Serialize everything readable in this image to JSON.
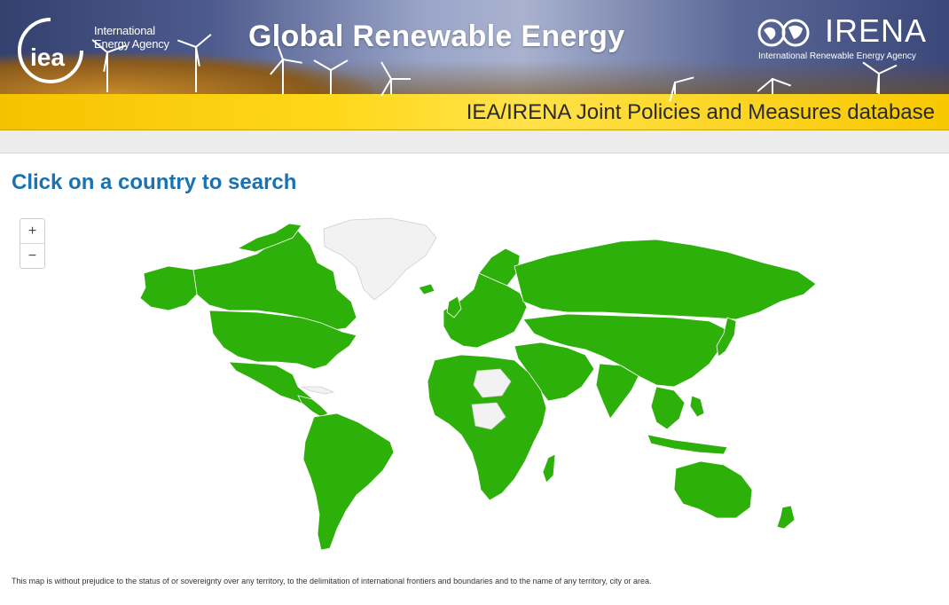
{
  "banner": {
    "iea_logo_text": "iea",
    "iea_org_line1": "International",
    "iea_org_line2": "Energy Agency",
    "title": "Global Renewable Energy",
    "irena_name": "IRENA",
    "irena_full_name": "International Renewable Energy Agency",
    "subtitle": "IEA/IRENA Joint Policies and Measures database"
  },
  "main": {
    "heading": "Click on a country to search"
  },
  "map_controls": {
    "zoom_in_label": "+",
    "zoom_out_label": "−"
  },
  "map": {
    "colors": {
      "covered_country": "#2eb00b",
      "not_covered_country": "#f2f2f2",
      "border": "#ffffff",
      "background": "#ffffff"
    }
  },
  "footer": {
    "disclaimer": "This map is without prejudice to the status of or sovereignty over any territory, to the delimitation of international frontiers and boundaries and to the name of any territory, city or area."
  },
  "colors": {
    "heading_blue": "#1a72b0",
    "banner_yellow": "#ffd81a"
  }
}
